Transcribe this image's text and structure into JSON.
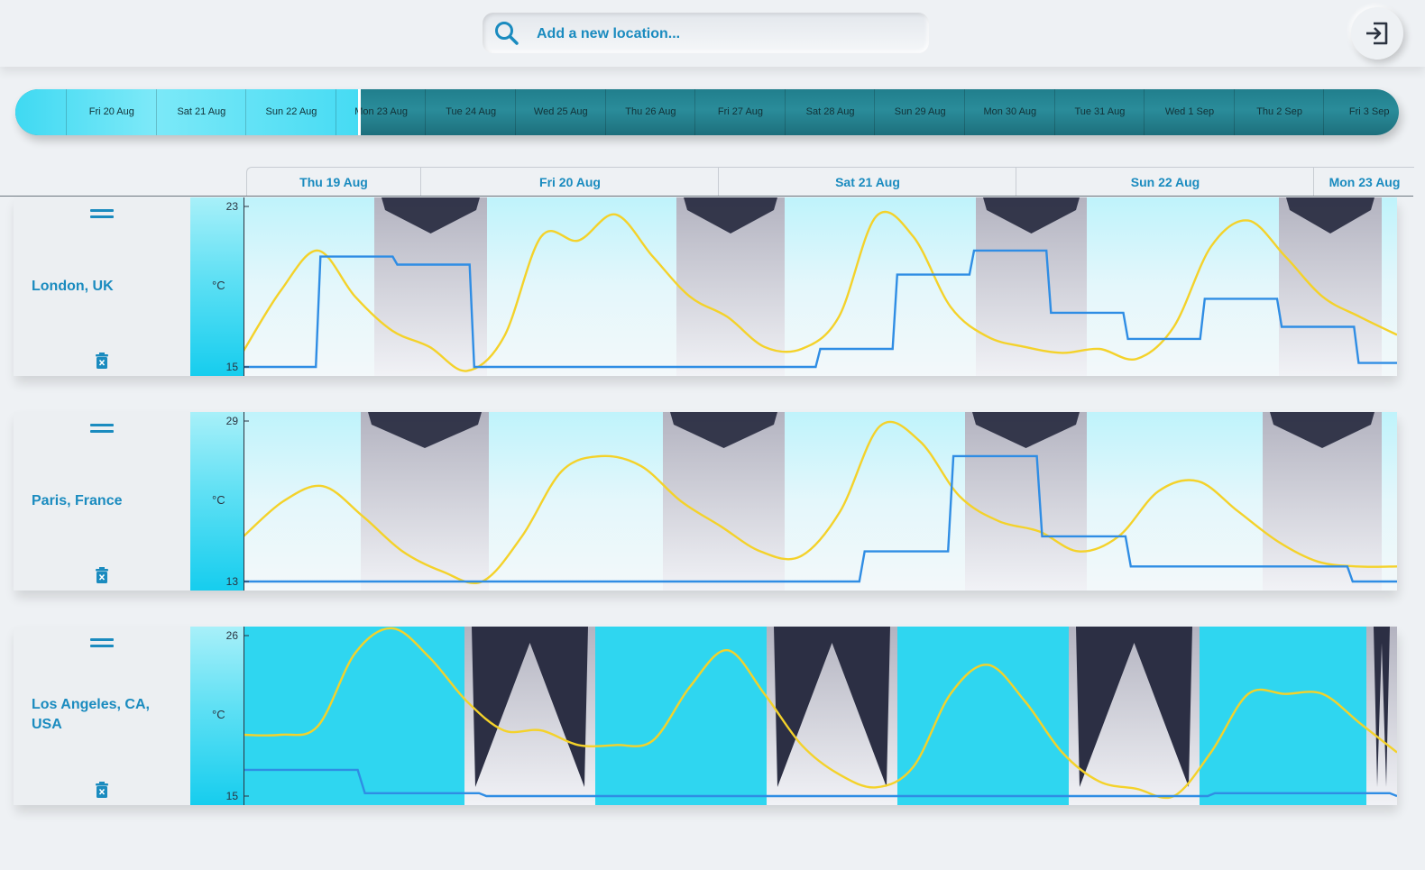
{
  "search": {
    "placeholder": "Add a new location..."
  },
  "header": {
    "logout_icon": "logout-icon"
  },
  "date_strip": {
    "selected_range": [
      "Fri 20 Aug",
      "Sat 21 Aug",
      "Sun 22 Aug"
    ],
    "days": [
      "Fri 20 Aug",
      "Sat 21 Aug",
      "Sun 22 Aug",
      "Mon 23 Aug",
      "Tue 24 Aug",
      "Wed 25 Aug",
      "Thu 26 Aug",
      "Fri 27 Aug",
      "Sat 28 Aug",
      "Sun 29 Aug",
      "Mon 30 Aug",
      "Tue 31 Aug",
      "Wed 1 Sep",
      "Thu 2 Sep",
      "Fri 3 Sep"
    ]
  },
  "day_header": [
    "Thu 19 Aug",
    "Fri 20 Aug",
    "Sat 21 Aug",
    "Sun 22 Aug",
    "Mon 23 Aug"
  ],
  "colors": {
    "temperature_line": "#f4d22a",
    "precipitation_line": "#2f8de4",
    "cloud_fill": "#a9f0f8",
    "night_fill": "#2c2f44",
    "accent": "#1a8bbf"
  },
  "locations": [
    {
      "name": "London, UK",
      "unit": "°C",
      "y_max": "23",
      "y_min": "15",
      "chart_data": {
        "type": "area",
        "y_axis": {
          "max": 23,
          "min": 15,
          "unit": "°C"
        },
        "x": [
          "Thu 19 Aug",
          "Fri 20 Aug",
          "Sat 21 Aug",
          "Sun 22 Aug",
          "Mon 23 Aug"
        ],
        "series": [
          {
            "values": [
              15.8,
              18.8,
              20.8,
              18.5,
              16.8,
              16.0,
              14.8,
              16.5,
              21.5,
              21.3,
              22.6,
              20.5,
              18.5,
              17.5,
              16.0,
              15.9,
              17.5,
              22.5,
              21.5,
              18.0,
              16.5,
              16.0,
              15.7,
              15.9,
              15.4,
              17.0,
              21.0,
              22.3,
              20.5,
              18.5,
              17.5,
              16.6
            ]
          },
          {
            "values": [
              15.0,
              15.0,
              20.5,
              20.5,
              20.1,
              20.1,
              15.0,
              15.0,
              15.0,
              15.0,
              15.0,
              15.0,
              15.0,
              15.0,
              15.0,
              15.9,
              15.9,
              19.6,
              19.6,
              20.8,
              20.8,
              17.7,
              17.7,
              16.4,
              16.4,
              18.4,
              18.4,
              17.0,
              17.0,
              15.2,
              15.2
            ]
          }
        ]
      }
    },
    {
      "name": "Paris, France",
      "unit": "°C",
      "y_max": "29",
      "y_min": "13",
      "chart_data": {
        "type": "area",
        "y_axis": {
          "max": 29,
          "min": 13,
          "unit": "°C"
        },
        "x": [
          "Thu 19 Aug",
          "Fri 20 Aug",
          "Sat 21 Aug",
          "Sun 22 Aug",
          "Mon 23 Aug"
        ],
        "series": [
          {
            "values": [
              17.5,
              21.0,
              22.5,
              19.5,
              16.0,
              14.0,
              13.0,
              17.5,
              24.0,
              25.5,
              24.5,
              21.0,
              18.5,
              16.0,
              15.5,
              20.0,
              28.5,
              27.0,
              21.5,
              19.0,
              18.0,
              16.0,
              17.5,
              22.0,
              23.0,
              20.0,
              17.0,
              15.0,
              14.5,
              14.5
            ]
          },
          {
            "values": [
              13.0,
              13.0,
              13.0,
              13.0,
              13.0,
              13.0,
              13.0,
              13.0,
              13.0,
              13.0,
              13.0,
              13.0,
              13.0,
              13.0,
              16.0,
              16.0,
              25.5,
              25.5,
              17.5,
              17.5,
              14.5,
              14.5,
              14.5,
              14.5,
              14.5,
              13.0,
              13.0
            ]
          }
        ]
      }
    },
    {
      "name": "Los Angeles, CA, USA",
      "unit": "°C",
      "y_max": "26",
      "y_min": "15",
      "chart_data": {
        "type": "area",
        "y_axis": {
          "max": 26,
          "min": 15,
          "unit": "°C"
        },
        "x": [
          "Thu 19 Aug",
          "Fri 20 Aug",
          "Sat 21 Aug",
          "Sun 22 Aug",
          "Mon 23 Aug"
        ],
        "series": [
          {
            "values": [
              19.2,
              19.2,
              19.8,
              24.8,
              26.5,
              24.5,
              21.5,
              19.5,
              19.5,
              18.5,
              18.5,
              18.8,
              22.5,
              25.0,
              22.0,
              18.5,
              16.5,
              15.6,
              17.0,
              22.0,
              24.0,
              21.5,
              18.0,
              16.0,
              15.5,
              15.0,
              18.0,
              22.0,
              22.0,
              22.0,
              20.0,
              18.0
            ]
          },
          {
            "values": [
              16.8,
              16.8,
              15.2,
              15.2,
              15.0,
              15.0,
              15.0,
              15.0,
              15.0,
              15.0,
              15.0,
              15.0,
              15.0,
              15.0,
              15.0,
              15.0,
              15.2,
              15.2,
              15.2,
              15.0
            ]
          }
        ]
      }
    }
  ]
}
